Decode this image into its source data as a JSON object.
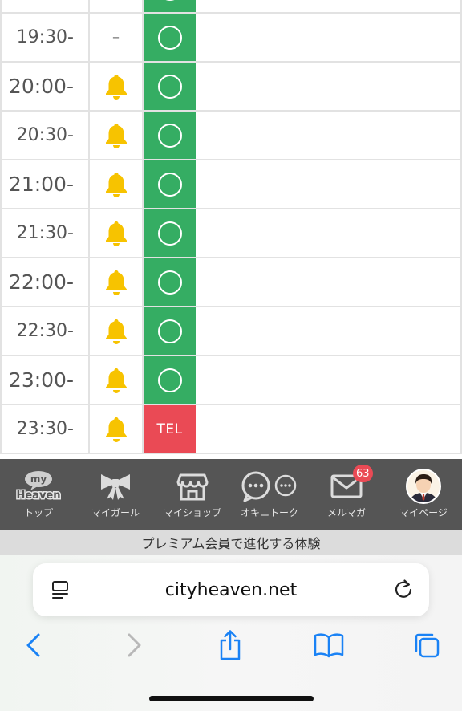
{
  "schedule": {
    "rows": [
      {
        "time": "",
        "notify": "",
        "status": "circle"
      },
      {
        "time": "19:30-",
        "notify": "–",
        "status": "circle"
      },
      {
        "time": "20:00-",
        "notify": "bell",
        "status": "circle"
      },
      {
        "time": "20:30-",
        "notify": "bell",
        "status": "circle"
      },
      {
        "time": "21:00-",
        "notify": "bell",
        "status": "circle"
      },
      {
        "time": "21:30-",
        "notify": "bell",
        "status": "circle"
      },
      {
        "time": "22:00-",
        "notify": "bell",
        "status": "circle"
      },
      {
        "time": "22:30-",
        "notify": "bell",
        "status": "circle"
      },
      {
        "time": "23:00-",
        "notify": "bell",
        "status": "circle"
      },
      {
        "time": "23:30-",
        "notify": "bell",
        "status": "TEL"
      }
    ],
    "colors": {
      "available": "#35ad63",
      "tel": "#ea4a55",
      "bell": "#f7c300"
    }
  },
  "app_nav": {
    "items": [
      {
        "label": "トップ",
        "icon": "my-heaven-logo-icon",
        "logo_line1": "my",
        "logo_line2": "Heaven"
      },
      {
        "label": "マイガール",
        "icon": "ribbon-icon"
      },
      {
        "label": "マイショップ",
        "icon": "shop-icon"
      },
      {
        "label": "オキニトーク",
        "icon": "chat-bubbles-icon"
      },
      {
        "label": "メルマガ",
        "icon": "mail-icon",
        "badge": "63"
      },
      {
        "label": "マイページ",
        "icon": "avatar-icon"
      }
    ]
  },
  "premium_banner": {
    "text": "プレミアム会員で進化する体験"
  },
  "browser": {
    "url": "cityheaven.net",
    "left_icon": "page-menu-icon",
    "right_icon": "reload-icon",
    "toolbar": [
      "back-icon",
      "forward-icon",
      "share-icon",
      "bookmarks-icon",
      "tabs-icon"
    ]
  }
}
